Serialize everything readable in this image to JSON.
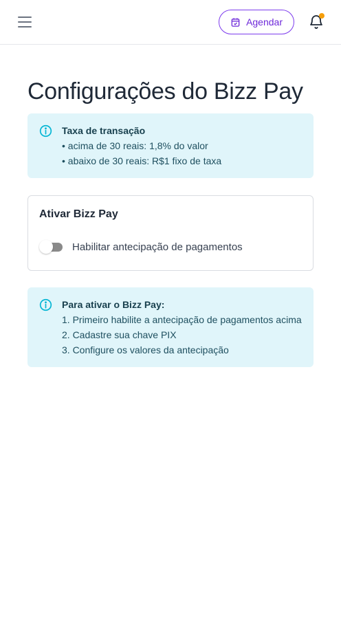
{
  "header": {
    "menu_icon": "hamburger-menu-icon",
    "schedule_label": "Agendar",
    "schedule_icon": "calendar-icon",
    "notification_icon": "bell-icon",
    "notification_dot_color": "#f59e0b",
    "accent_color": "#7c3aed"
  },
  "page": {
    "title": "Configurações do Bizz Pay"
  },
  "fee_info": {
    "icon": "info-icon",
    "title": "Taxa de transação",
    "lines": [
      "• acima de 30 reais: 1,8% do valor",
      "• abaixo de 30 reais: R$1 fixo de taxa"
    ]
  },
  "activation_card": {
    "title": "Ativar Bizz Pay",
    "toggle": {
      "label": "Habilitar antecipação de pagamentos",
      "enabled": false
    }
  },
  "steps_info": {
    "icon": "info-icon",
    "title": "Para ativar o Bizz Pay:",
    "steps": [
      "1. Primeiro habilite a antecipação de pagamentos acima",
      "2. Cadastre sua chave PIX",
      "3. Configure os valores da antecipação"
    ]
  }
}
